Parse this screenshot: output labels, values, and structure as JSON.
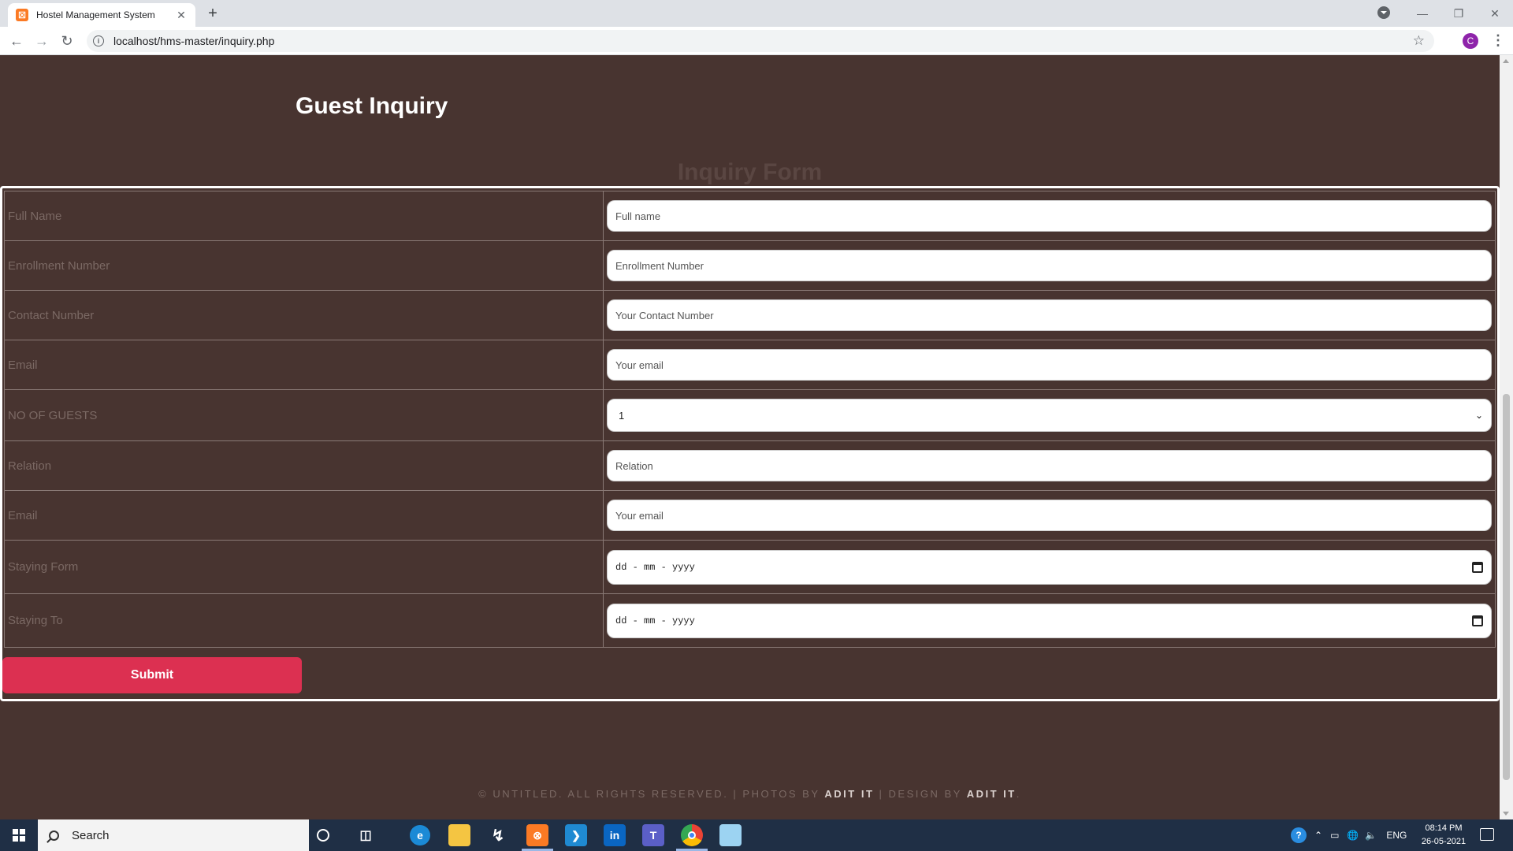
{
  "browser": {
    "tab_title": "Hostel Management System",
    "tab_favicon_letter": "☒",
    "new_tab_symbol": "+",
    "close_symbol": "✕",
    "url": "localhost/hms-master/inquiry.php",
    "profile_initial": "C",
    "icons": [
      "back-icon",
      "forward-icon",
      "reload-icon",
      "info-icon",
      "star-icon",
      "menu-icon",
      "tab-search-icon",
      "minimize-icon",
      "restore-icon",
      "close-icon"
    ]
  },
  "page": {
    "title": "Guest Inquiry",
    "form_title": "Inquiry Form",
    "fields": {
      "full_name": {
        "label": "Full Name",
        "placeholder": "Full name"
      },
      "enrollment": {
        "label": "Enrollment Number",
        "placeholder": "Enrollment Number"
      },
      "contact": {
        "label": "Contact Number",
        "placeholder": "Your Contact Number"
      },
      "email": {
        "label": "Email",
        "placeholder": "Your email"
      },
      "guests": {
        "label": "NO OF GUESTS",
        "value": "1"
      },
      "relation": {
        "label": "Relation",
        "placeholder": "Relation"
      },
      "email2": {
        "label": "Email",
        "placeholder": "Your email"
      },
      "staying_from": {
        "label": "Staying Form",
        "value": "dd - mm - yyyy"
      },
      "staying_to": {
        "label": "Staying To",
        "value": "dd - mm - yyyy"
      }
    },
    "submit_label": "Submit",
    "footer": {
      "prefix": "© UNTITLED. ALL RIGHTS RESERVED. | PHOTOS BY ",
      "photos_by": "ADIT IT",
      "middle": " | DESIGN BY ",
      "design_by": "ADIT IT",
      "suffix": "."
    },
    "colors": {
      "background": "#483430",
      "submit": "#dc3051",
      "text_label": "#7b6964"
    }
  },
  "taskbar": {
    "search_label": "Search",
    "language": "ENG",
    "time": "08:14 PM",
    "date": "26-05-2021",
    "apps": [
      "cortana-icon",
      "task-view-icon",
      "edge-icon",
      "file-explorer-icon",
      "sublime-icon",
      "xampp-icon",
      "vscode-icon",
      "linkedin-icon",
      "teams-icon",
      "chrome-icon",
      "notepad-icon"
    ]
  }
}
